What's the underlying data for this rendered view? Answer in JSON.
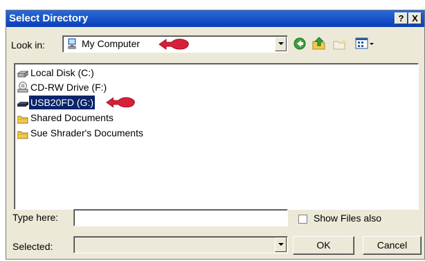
{
  "window": {
    "title": "Select Directory",
    "help_label": "?",
    "close_label": "X"
  },
  "look_in": {
    "label": "Look in:",
    "value": "My Computer"
  },
  "items": [
    {
      "label": "Local Disk (C:)",
      "icon": "hard-disk-icon"
    },
    {
      "label": "CD-RW Drive (F:)",
      "icon": "cd-drive-icon"
    },
    {
      "label": "USB20FD (G:)",
      "icon": "removable-drive-icon",
      "selected": true
    },
    {
      "label": "Shared Documents",
      "icon": "folder-icon"
    },
    {
      "label": "Sue Shrader's Documents",
      "icon": "folder-icon"
    }
  ],
  "type_here": {
    "label": "Type here:",
    "value": ""
  },
  "show_files": {
    "label": "Show Files also",
    "checked": false
  },
  "selected": {
    "label": "Selected:",
    "value": ""
  },
  "buttons": {
    "ok": "OK",
    "cancel": "Cancel"
  },
  "colors": {
    "title_bar": "#0a3fb8",
    "selection": "#0a246a",
    "annotation_arrow": "#d8203a"
  }
}
